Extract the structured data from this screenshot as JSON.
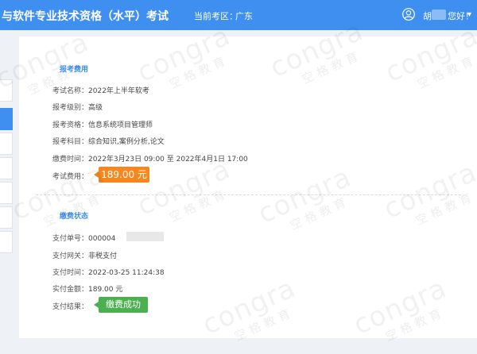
{
  "header": {
    "title": "与软件专业技术资格（水平）考试",
    "region_label": "当前考区：",
    "region_value": "广东",
    "username": "胡",
    "greeting": "您好！",
    "caret": "▾"
  },
  "fee_section": {
    "title": "报考费用",
    "rows": [
      {
        "label": "考试名称：",
        "value": "2022年上半年软考"
      },
      {
        "label": "报考级别：",
        "value": "高级"
      },
      {
        "label": "报考资格：",
        "value": "信息系统项目管理师"
      },
      {
        "label": "报考科目：",
        "value": "综合知识,案例分析,论文"
      },
      {
        "label": "缴费时间：",
        "value": "2022年3月23日 09:00 至 2022年4月1日 17:00"
      }
    ],
    "fee_label": "考试费用：",
    "fee_value": "189.00 元"
  },
  "payment_section": {
    "title": "缴费状态",
    "rows": [
      {
        "label": "支付单号：",
        "value": "000004"
      },
      {
        "label": "支付网关：",
        "value": "非税支付"
      },
      {
        "label": "支付时间：",
        "value": "2022-03-25 11:24:38"
      },
      {
        "label": "实付金额：",
        "value": "189.00 元"
      }
    ],
    "result_label": "支付结果：",
    "result_value": "缴费成功"
  },
  "watermark": {
    "brand": "congra",
    "tagline": "空格教育"
  },
  "colors": {
    "primary": "#3f8ff0",
    "fee_badge": "#f4881e",
    "success_badge": "#4cb050"
  }
}
